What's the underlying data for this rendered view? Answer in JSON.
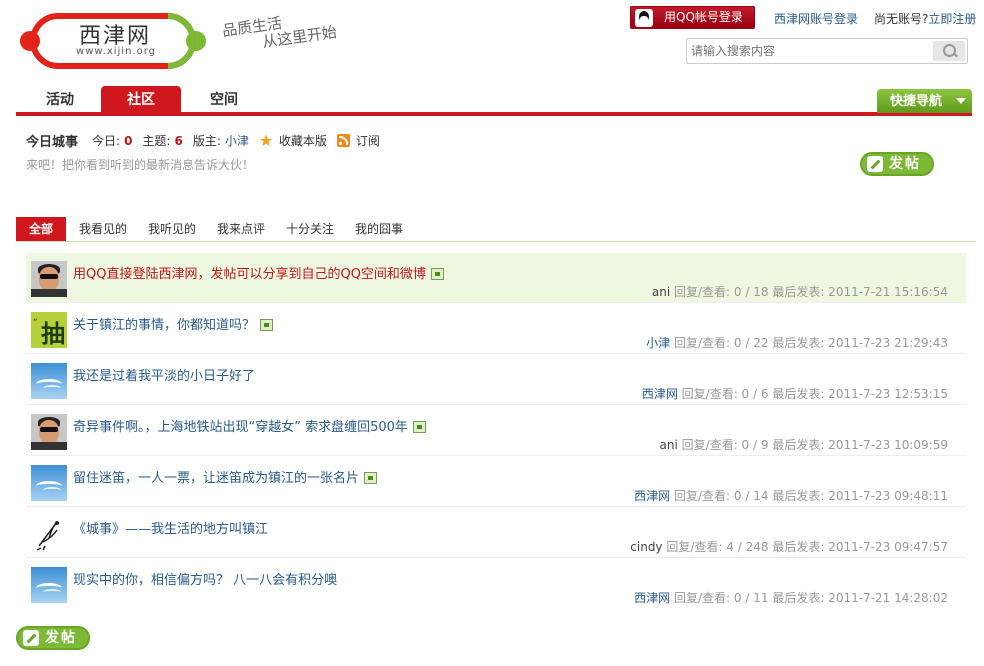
{
  "header": {
    "logo_text": "西津网",
    "logo_url": "www.xijin.org",
    "slogan_line1": "品质生活",
    "slogan_line2": "从这里开始",
    "qq_login": "用QQ帐号登录",
    "site_login": "西津网账号登录",
    "register_prefix": "尚无账号?",
    "register_link": "立即注册",
    "search_placeholder": "请输入搜索内容"
  },
  "nav": {
    "tabs": [
      {
        "label": "活动"
      },
      {
        "label": "社区"
      },
      {
        "label": "空间"
      }
    ],
    "active_tab": "社区",
    "quick_nav": "快捷导航"
  },
  "forum": {
    "title": "今日城事",
    "today_label": "今日:",
    "today_count": "0",
    "topics_label": "主题:",
    "topics_count": "6",
    "moderator_label": "版主:",
    "moderator": "小津",
    "favorite": "收藏本版",
    "subscribe": "订阅",
    "description": "来吧！把你看到听到的最新消息告诉大伙！",
    "post_button": "发帖"
  },
  "filters": [
    {
      "label": "全部"
    },
    {
      "label": "我看见的"
    },
    {
      "label": "我听见的"
    },
    {
      "label": "我来点评"
    },
    {
      "label": "十分关注"
    },
    {
      "label": "我的囧事"
    }
  ],
  "threads": [
    {
      "title": "用QQ直接登陆西津网，发帖可以分享到自己的QQ空间和微博",
      "author": "ani",
      "stats": "回复/查看: 0 / 18",
      "last_post": "最后发表: 2011-7-21 15:16:54",
      "has_image": true,
      "avatar": "person"
    },
    {
      "title": "关于镇江的事情，你都知道吗？",
      "author": "小津",
      "stats": "回复/查看: 0 / 22",
      "last_post": "最后发表: 2011-7-23 21:29:43",
      "has_image": true,
      "avatar": "green"
    },
    {
      "title": "我还是过着我平淡的小日子好了",
      "author": "西津网",
      "stats": "回复/查看: 0 / 6",
      "last_post": "最后发表: 2011-7-23 12:53:15",
      "has_image": false,
      "avatar": "sky"
    },
    {
      "title": "奇异事件啊。，上海地铁站出现“穿越女” 索求盘缠回500年",
      "author": "ani",
      "stats": "回复/查看: 0 / 9",
      "last_post": "最后发表: 2011-7-23 10:09:59",
      "has_image": true,
      "avatar": "person"
    },
    {
      "title": "留住迷笛，一人一票，让迷笛成为镇江的一张名片",
      "author": "西津网",
      "stats": "回复/查看: 0 / 14",
      "last_post": "最后发表: 2011-7-23 09:48:11",
      "has_image": true,
      "avatar": "sky"
    },
    {
      "title": "《城事》——我生活的地方叫镇江",
      "author": "cindy",
      "stats": "回复/查看: 4 / 248",
      "last_post": "最后发表: 2011-7-23 09:47:57",
      "has_image": false,
      "avatar": "sketch"
    },
    {
      "title": "现实中的你，相信偏方吗？ 八一八会有积分噢",
      "author": "西津网",
      "stats": "回复/查看: 0 / 11",
      "last_post": "最后发表: 2011-7-21 14:28:02",
      "has_image": false,
      "avatar": "sky"
    }
  ],
  "colors": {
    "brand_red": "#d0171d",
    "accent_green": "#7cb934",
    "link_blue": "#2a5b8c"
  }
}
